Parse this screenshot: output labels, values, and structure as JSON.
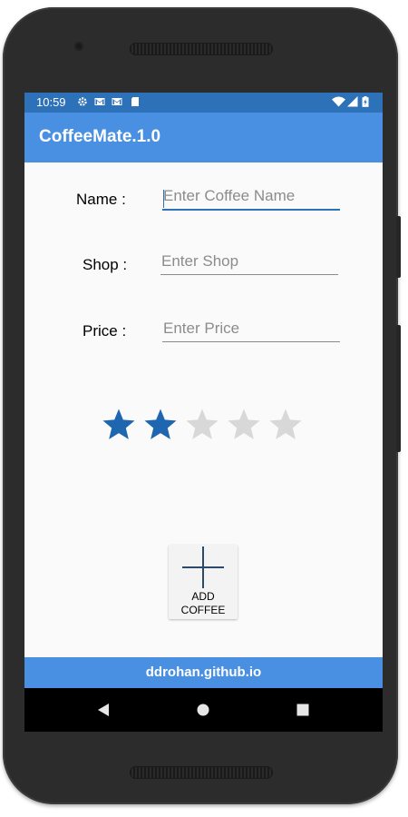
{
  "status_bar": {
    "time": "10:59",
    "left_icons": [
      "gear-icon",
      "gmail-icon",
      "gmail-icon",
      "sd-card-icon"
    ],
    "right_icons": [
      "wifi-icon",
      "signal-icon",
      "battery-charging-icon"
    ]
  },
  "app_bar": {
    "title": "CoffeeMate.1.0"
  },
  "form": {
    "name_label": "Name :",
    "name_placeholder": "Enter Coffee Name",
    "shop_label": "Shop :",
    "shop_placeholder": "Enter Shop",
    "price_label": "Price :",
    "price_placeholder": "Enter Price"
  },
  "rating": {
    "value": 2,
    "max": 5
  },
  "add_button": {
    "label": "ADD\nCOFFEE"
  },
  "footer": {
    "text": "ddrohan.github.io"
  },
  "nav_bar": {
    "buttons": [
      "back-icon",
      "home-icon",
      "recents-icon"
    ]
  },
  "colors": {
    "status_bar": "#2d72b8",
    "app_bar": "#4a90e2",
    "star_filled": "#1f66b0",
    "star_empty": "#d8d8d8"
  }
}
